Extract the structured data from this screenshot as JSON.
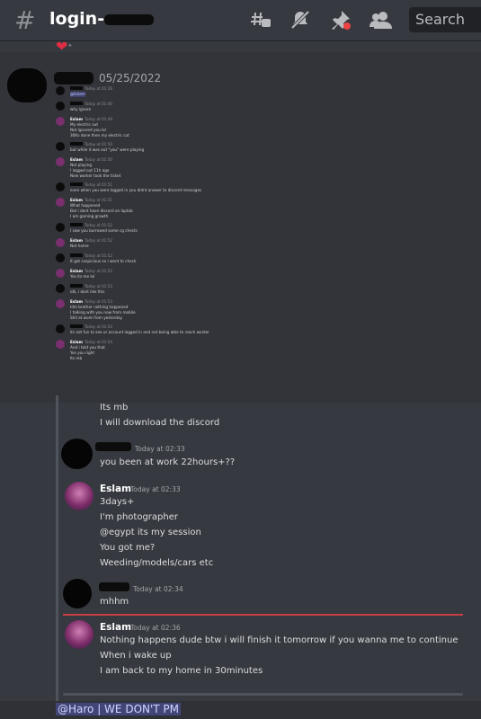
{
  "header": {
    "channel_name": "login-",
    "search_placeholder": "Search",
    "icons": [
      "threads-icon",
      "mute-icon",
      "pin-icon",
      "members-icon"
    ]
  },
  "embedded_screenshot": {
    "date": "05/25/2022",
    "messages": [
      {
        "author": "",
        "time": "Today at 01:26",
        "lines": [
          "@Eslam"
        ]
      },
      {
        "author": "",
        "time": "Today at 01:40",
        "lines": [
          "why ignore"
        ]
      },
      {
        "author": "Eslam",
        "time": "Today at 01:49",
        "lines": [
          "My electric out",
          "Not Ignored you lol",
          "30Kv done then my electric cut"
        ]
      },
      {
        "author": "",
        "time": "Today at 01:50",
        "lines": [
          "but while it was out \"you\" were playing"
        ]
      },
      {
        "author": "Eslam",
        "time": "Today at 01:50",
        "lines": [
          "Not playing",
          "I logged out 11h ago",
          "New worker took the ticket"
        ]
      },
      {
        "author": "",
        "time": "Today at 01:51",
        "lines": [
          "even when you were logged in you didnt answer to discord messages"
        ]
      },
      {
        "author": "Eslam",
        "time": "Today at 01:51",
        "lines": [
          "What happened",
          "But i dont have discord on laptab",
          "I am gaming growth"
        ]
      },
      {
        "author": "",
        "time": "Today at 01:52",
        "lines": [
          "I saw you burrowed some cg chests"
        ]
      },
      {
        "author": "Eslam",
        "time": "Today at 01:52",
        "lines": [
          "Not home"
        ]
      },
      {
        "author": "",
        "time": "Today at 01:52",
        "lines": [
          "It got suspicious so i went to check"
        ]
      },
      {
        "author": "Eslam",
        "time": "Today at 01:52",
        "lines": [
          "Yes its me lol"
        ]
      },
      {
        "author": "",
        "time": "Today at 01:53",
        "lines": [
          "idk, i dont like this"
        ]
      },
      {
        "author": "Eslam",
        "time": "Today at 01:53",
        "lines": [
          "Idm brother nothing happened",
          "I talking with you now from mobile",
          "Still at work from yesterday"
        ]
      },
      {
        "author": "",
        "time": "Today at 01:54",
        "lines": [
          "its not fun to see ur account logged in and not being able to reach worker"
        ]
      },
      {
        "author": "Eslam",
        "time": "Today at 01:54",
        "lines": [
          "And i told you that",
          "Yes you right",
          "Its mb"
        ]
      }
    ]
  },
  "messages": [
    {
      "lines": [
        "Its mb",
        "I will download the discord"
      ]
    },
    {
      "author": "",
      "time": "Today at 02:33",
      "lines": [
        "you been at work 22hours+??"
      ]
    },
    {
      "author": "Eslam",
      "time": "Today at 02:33",
      "lines": [
        "3days+",
        "I'm photographer",
        "@egypt its my session",
        "You got me?",
        "Weeding/models/cars etc"
      ]
    },
    {
      "author": "",
      "time": "Today at 02:34",
      "lines": [
        "mhhm"
      ]
    },
    {
      "author": "Eslam",
      "time": "Today at 02:36",
      "lines": [
        "Nothing happens dude btw i will finish it tomorrow if you wanna me to continue",
        "When i wake up",
        "I am back to my home in 30minutes"
      ]
    }
  ],
  "footer": {
    "mention": "@Haro | WE DON'T PM"
  }
}
